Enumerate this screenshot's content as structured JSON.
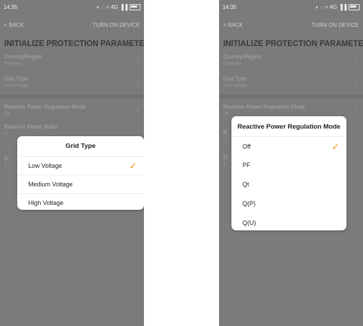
{
  "left": {
    "status": {
      "time": "14:35",
      "icons_left": "≈ Ʌ ● ▣ ©",
      "icons_right": "◐ ◌ ≈ 4G ▐▐",
      "battery": "83%"
    },
    "nav": {
      "back": "< BACK",
      "action": "TURN ON DEVICE"
    },
    "title": "INITIALIZE PROTECTION PARAMETER",
    "fields": [
      {
        "label": "Country/Region",
        "value": "Germany"
      },
      {
        "label": "Grid Type",
        "value": "Low Voltage"
      },
      {
        "label": "Reactive Power Regulation Mode",
        "value": "Off"
      },
      {
        "label": "Reactive Power Ratio",
        "value": "0"
      },
      {
        "label": "D",
        "value": "1"
      }
    ],
    "dialog": {
      "title": "Grid Type",
      "options": [
        "Low Voltage",
        "Medium Voltage",
        "High Voltage"
      ],
      "selected": "Low Voltage"
    }
  },
  "right": {
    "status": {
      "time": "14:35",
      "icons_left": "≈ Ʌ ● ▣ ©",
      "icons_right": "◐ ◌ ≈ 4G ▐▐",
      "battery": "82%"
    },
    "nav": {
      "back": "< BACK",
      "action": "TURN ON DEVICE"
    },
    "title": "INITIALIZE PROTECTION PARAMETER",
    "fields": [
      {
        "label": "Country/Region",
        "value": "Germany"
      },
      {
        "label": "Grid Type",
        "value": "Low Voltage"
      },
      {
        "label": "Reactive Power Regulation Mode",
        "value": "Of"
      },
      {
        "label": "R",
        "value": "0."
      },
      {
        "label": "D",
        "value": "1"
      }
    ],
    "dialog": {
      "title": "Reactive Power Regulation Mode",
      "options": [
        "Off",
        "PF",
        "Qt",
        "Q(P)",
        "Q(U)"
      ],
      "selected": "Off"
    }
  },
  "colors": {
    "accent": "#f2a020",
    "overlay": "#7b7b7b"
  }
}
